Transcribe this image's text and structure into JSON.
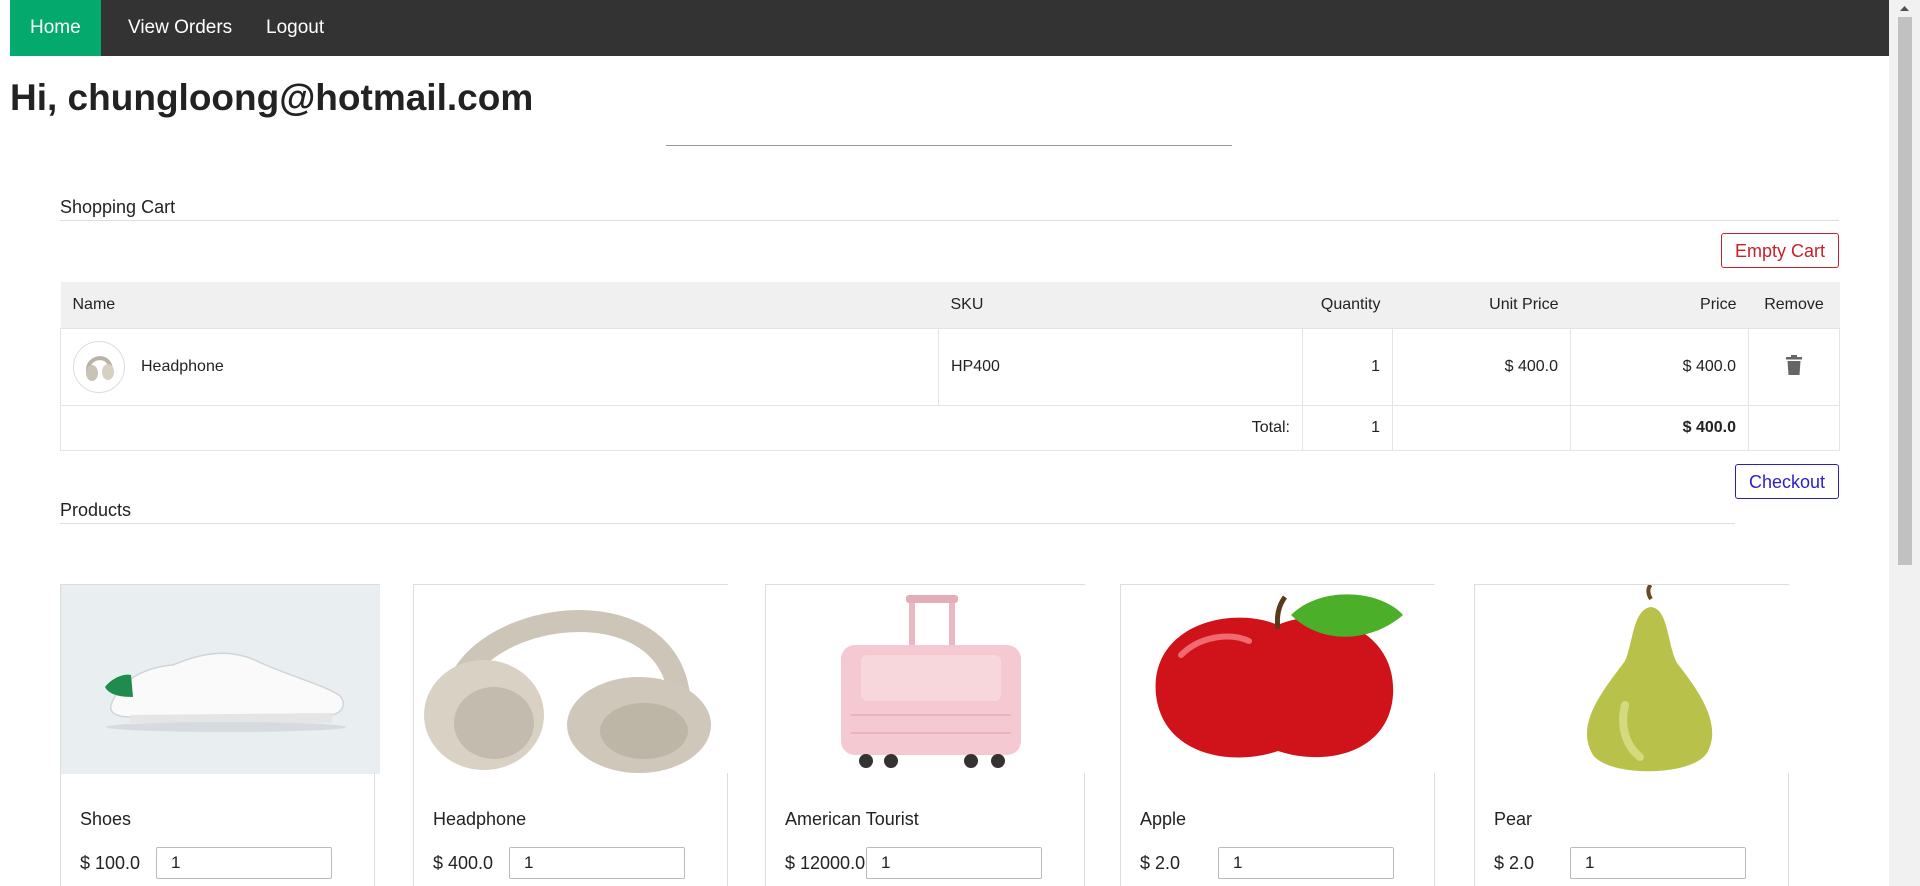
{
  "nav": {
    "home": "Home",
    "orders": "View Orders",
    "logout": "Logout"
  },
  "greeting": "Hi, chungloong@hotmail.com",
  "cart": {
    "title": "Shopping Cart",
    "empty_label": "Empty Cart",
    "columns": [
      "Name",
      "SKU",
      "Quantity",
      "Unit Price",
      "Price",
      "Remove"
    ],
    "rows": [
      {
        "name": "Headphone",
        "sku": "HP400",
        "quantity": "1",
        "unit_price": "$ 400.0",
        "price": "$ 400.0",
        "image_icon": "headphone-image"
      }
    ],
    "total_label": "Total:",
    "total_quantity": "1",
    "total_price": "$ 400.0",
    "checkout_label": "Checkout",
    "remove_icon": "trash-icon"
  },
  "products": {
    "title": "Products",
    "items": [
      {
        "name": "Shoes",
        "price": "$ 100.0",
        "qty": "1",
        "image_icon": "shoe-image"
      },
      {
        "name": "Headphone",
        "price": "$ 400.0",
        "qty": "1",
        "image_icon": "headphone-image"
      },
      {
        "name": "American Tourist",
        "price": "$ 12000.0",
        "qty": "1",
        "image_icon": "suitcase-image"
      },
      {
        "name": "Apple",
        "price": "$ 2.0",
        "qty": "1",
        "image_icon": "apple-image"
      },
      {
        "name": "Pear",
        "price": "$ 2.0",
        "qty": "1",
        "image_icon": "pear-image"
      }
    ]
  },
  "colors": {
    "nav_bg": "#333333",
    "nav_active": "#04aa6d",
    "danger": "#c9202b",
    "primary": "#2a1fc7"
  }
}
